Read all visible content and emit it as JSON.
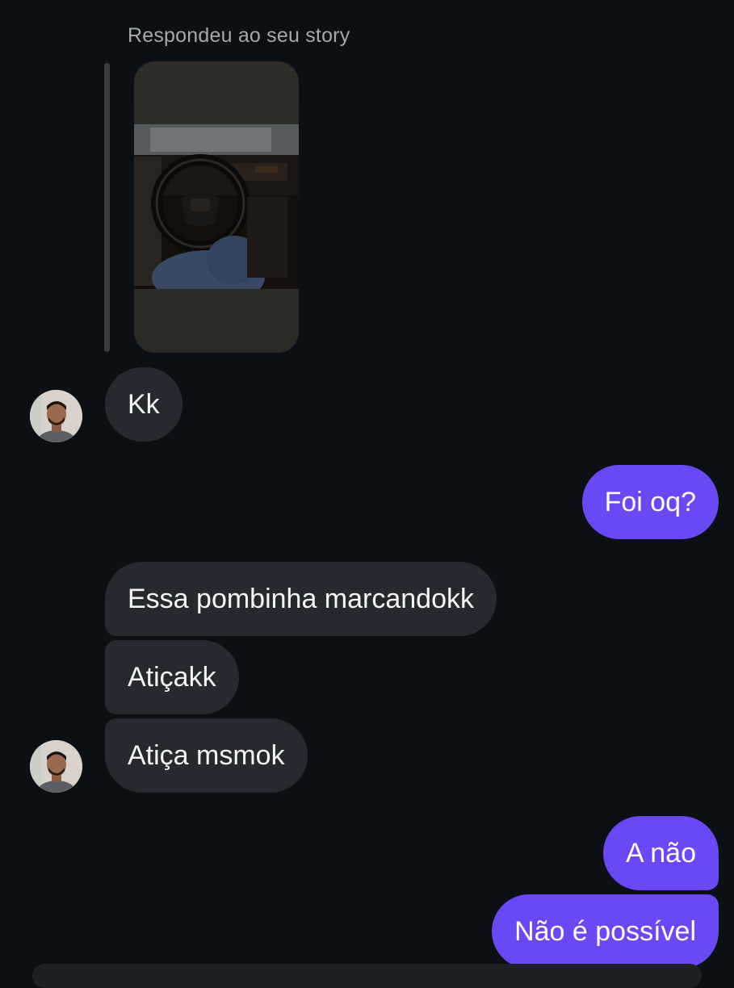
{
  "story_reply": {
    "caption": "Respondeu ao seu story"
  },
  "messages": [
    {
      "id": "m1",
      "side": "in",
      "text": "Kk"
    },
    {
      "id": "m2",
      "side": "out",
      "text": "Foi oq?"
    },
    {
      "id": "m3",
      "side": "in",
      "text": "Essa pombinha marcandokk"
    },
    {
      "id": "m4",
      "side": "in",
      "text": "Atiçakk"
    },
    {
      "id": "m5",
      "side": "in",
      "text": "Atiça msmok"
    },
    {
      "id": "m6",
      "side": "out",
      "text": "A não"
    },
    {
      "id": "m7",
      "side": "out",
      "text": "Não é possível"
    }
  ],
  "colors": {
    "background": "#0c1014",
    "incoming_bubble": "#262a30",
    "outgoing_bubble": "#6948f5",
    "caption_text": "#a8a8a8"
  },
  "icons": {
    "avatar": "contact-avatar",
    "story_thumbnail": "story-photo-steering-wheel"
  }
}
